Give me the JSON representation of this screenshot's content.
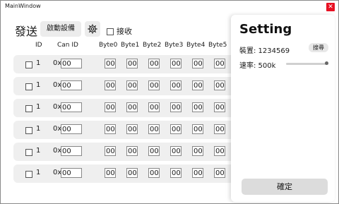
{
  "window": {
    "title": "MainWindow",
    "close_glyph": "✕"
  },
  "toolbar": {
    "send_label": "發送",
    "start_label": "啟動設備",
    "gear_icon": "gear-icon",
    "receive_label": "接收",
    "receive_checked": false
  },
  "table": {
    "headers": [
      "ID",
      "Can ID",
      "Byte0",
      "Byte1",
      "Byte2",
      "Byte3",
      "Byte4",
      "Byte5"
    ],
    "id_prefix": "0x",
    "rows": [
      {
        "checked": false,
        "id": "1",
        "can_id": "00",
        "bytes": [
          "00",
          "00",
          "00",
          "00",
          "00",
          "00"
        ]
      },
      {
        "checked": false,
        "id": "1",
        "can_id": "00",
        "bytes": [
          "00",
          "00",
          "00",
          "00",
          "00",
          "00"
        ]
      },
      {
        "checked": false,
        "id": "1",
        "can_id": "00",
        "bytes": [
          "00",
          "00",
          "00",
          "00",
          "00",
          "00"
        ]
      },
      {
        "checked": false,
        "id": "1",
        "can_id": "00",
        "bytes": [
          "00",
          "00",
          "00",
          "00",
          "00",
          "00"
        ]
      },
      {
        "checked": false,
        "id": "1",
        "can_id": "00",
        "bytes": [
          "00",
          "00",
          "00",
          "00",
          "00",
          "00"
        ]
      },
      {
        "checked": false,
        "id": "1",
        "can_id": "00",
        "bytes": [
          "00",
          "00",
          "00",
          "00",
          "00",
          "00"
        ]
      }
    ]
  },
  "setting": {
    "title": "Setting",
    "device_label": "裝置: 1234569",
    "search_label": "搜尋",
    "rate_label": "速率:  500k",
    "rate_slider_fraction": 1.0,
    "confirm_label": "確定"
  }
}
